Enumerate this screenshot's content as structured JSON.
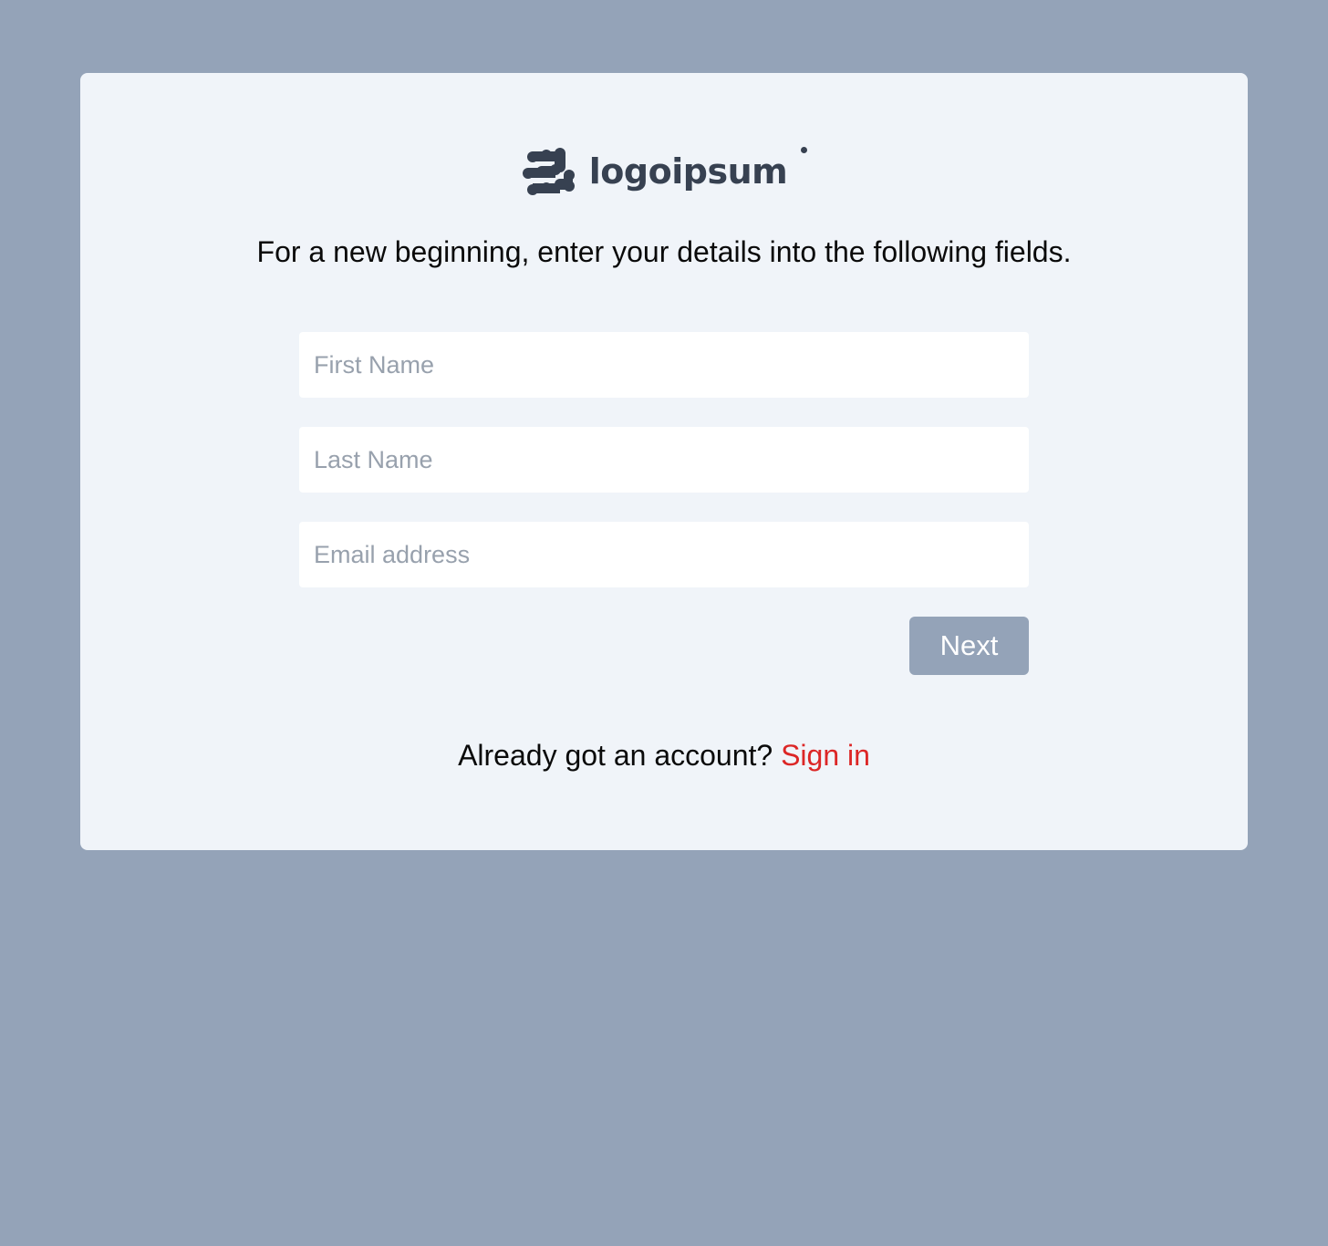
{
  "brand": {
    "name": "logoipsum",
    "color": "#374151"
  },
  "intro_text": "For a new beginning, enter your details into the following fields.",
  "form": {
    "first_name": {
      "placeholder": "First Name",
      "value": ""
    },
    "last_name": {
      "placeholder": "Last Name",
      "value": ""
    },
    "email": {
      "placeholder": "Email address",
      "value": ""
    },
    "next_label": "Next"
  },
  "footer": {
    "prompt": "Already got an account?",
    "signin_label": "Sign in",
    "signin_color": "#dc2626"
  },
  "colors": {
    "page_background": "#94a3b8",
    "card_background": "#f0f4f9",
    "button_background": "#94a3b8"
  }
}
